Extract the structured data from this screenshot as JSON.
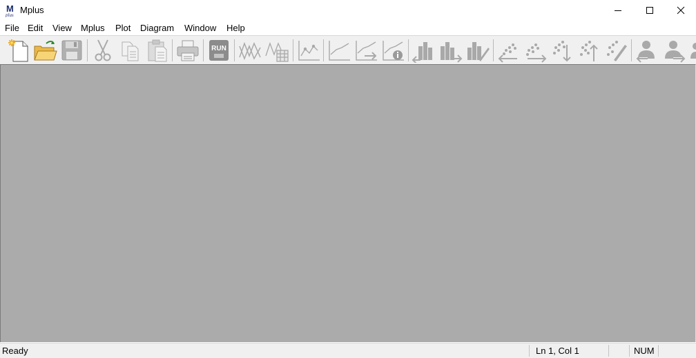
{
  "window": {
    "title": "Mplus",
    "icon": "mplus-logo",
    "icon_letter": "M",
    "icon_subtext": "plus",
    "controls": [
      "minimize-icon",
      "maximize-icon",
      "close-icon"
    ]
  },
  "menu": {
    "items": [
      {
        "label": "File"
      },
      {
        "label": "Edit"
      },
      {
        "label": "View"
      },
      {
        "label": "Mplus"
      },
      {
        "label": "Plot"
      },
      {
        "label": "Diagram"
      },
      {
        "label": "Window"
      },
      {
        "label": "Help"
      }
    ]
  },
  "toolbar": {
    "buttons": [
      {
        "icon": "new-file-icon",
        "enabled": true
      },
      {
        "icon": "open-folder-icon",
        "enabled": true
      },
      {
        "icon": "save-icon",
        "enabled": false
      },
      {
        "icon": "cut-icon",
        "enabled": false
      },
      {
        "icon": "copy-icon",
        "enabled": false
      },
      {
        "icon": "paste-icon",
        "enabled": false
      },
      {
        "icon": "print-icon",
        "enabled": false
      },
      {
        "icon": "run-icon",
        "enabled": false,
        "label": "RUN"
      },
      {
        "icon": "plot-lines-icon",
        "enabled": false
      },
      {
        "icon": "plot-table-icon",
        "enabled": false
      },
      {
        "icon": "plot-view-icon",
        "enabled": false
      },
      {
        "icon": "plot-line-icon",
        "enabled": false
      },
      {
        "icon": "plot-line-arrow-icon",
        "enabled": false
      },
      {
        "icon": "plot-line-info-icon",
        "enabled": false
      },
      {
        "icon": "histogram-left-icon",
        "enabled": false
      },
      {
        "icon": "histogram-right-icon",
        "enabled": false
      },
      {
        "icon": "histogram-edit-icon",
        "enabled": false
      },
      {
        "icon": "scatter-left-icon",
        "enabled": false
      },
      {
        "icon": "scatter-right-icon",
        "enabled": false
      },
      {
        "icon": "scatter-down-icon",
        "enabled": false
      },
      {
        "icon": "scatter-up-icon",
        "enabled": false
      },
      {
        "icon": "scatter-edit-icon",
        "enabled": false
      },
      {
        "icon": "person-left-icon",
        "enabled": false
      },
      {
        "icon": "person-right-icon",
        "enabled": false
      },
      {
        "icon": "person-more-icon",
        "enabled": false
      }
    ]
  },
  "status": {
    "text": "Ready",
    "position": "Ln 1, Col 1",
    "numlock": "NUM"
  },
  "colors": {
    "workspace": "#ababab",
    "toolbar": "#f0f0f0",
    "disabled_icon": "#a9a9a9"
  }
}
